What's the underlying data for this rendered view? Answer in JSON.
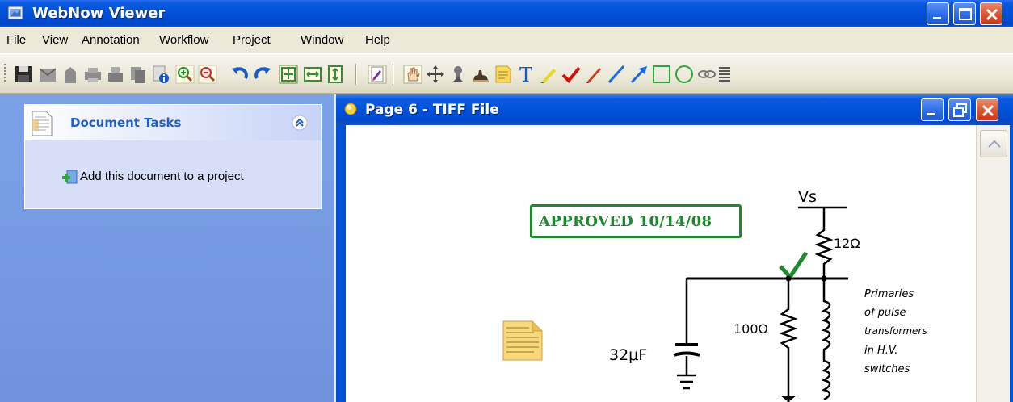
{
  "app": {
    "title": "WebNow Viewer",
    "accent": "#0050d8"
  },
  "menu": [
    "File",
    "View",
    "Annotation",
    "Workflow",
    "Project",
    "Window",
    "Help"
  ],
  "toolbar": {
    "icons": [
      "save-icon",
      "send-icon",
      "archive-icon",
      "print-icon",
      "fax-icon",
      "copy-icon",
      "properties-icon",
      "zoom-in-icon",
      "zoom-out-icon",
      "rotate-left-icon",
      "rotate-right-icon",
      "fit-page-icon",
      "fit-width-icon",
      "fit-height-icon",
      "annotate-toggle-icon",
      "pan-hand-icon",
      "move-icon",
      "stamp-icon",
      "rubber-stamp-icon",
      "sticky-note-icon",
      "text-icon",
      "highlighter-icon",
      "checkmark-icon",
      "pen-icon",
      "line-icon",
      "arrow-icon",
      "rectangle-icon",
      "ellipse-icon",
      "link-icon",
      "more-icon"
    ]
  },
  "tasks": {
    "header": "Document Tasks",
    "items": [
      {
        "label": "Add this document to a project"
      }
    ]
  },
  "document": {
    "title": "Page 6 - TIFF File",
    "stamp": "APPROVED 10/14/08",
    "stamp_color": "#1c8a2c",
    "labels": {
      "vs": "Vs",
      "r1": "12Ω",
      "cap": "32μF",
      "r2": "100Ω",
      "note_line1": "Primaries",
      "note_line2": "of pulse",
      "note_line3": "transformers",
      "note_line4": "in H.V.",
      "note_line5": "switches"
    }
  }
}
